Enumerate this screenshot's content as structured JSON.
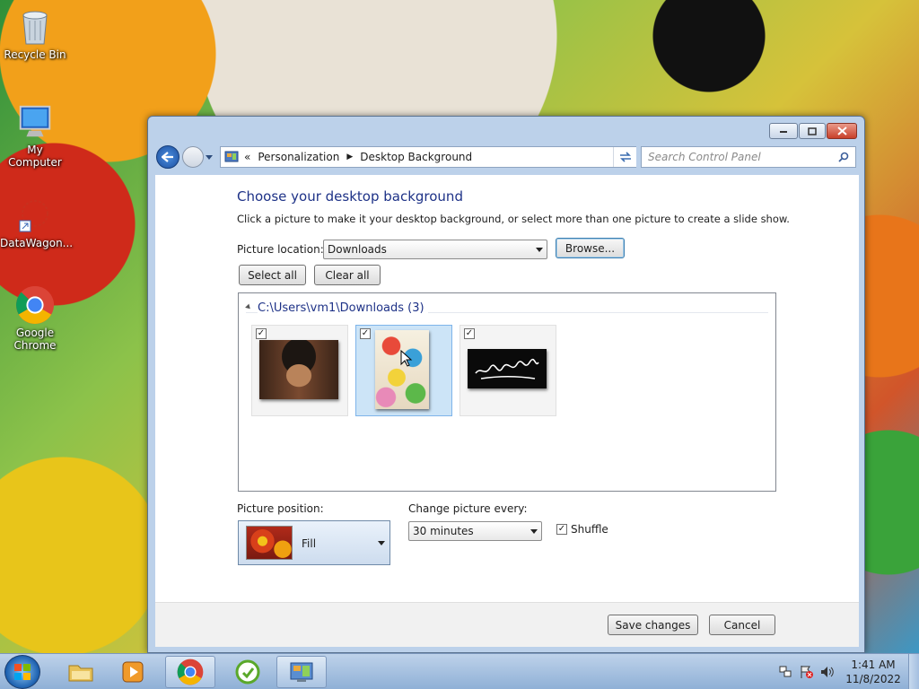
{
  "desktop": {
    "icons": [
      {
        "label": "Recycle Bin",
        "icon": "recycle-bin-icon"
      },
      {
        "label": "My Computer",
        "icon": "computer-icon"
      },
      {
        "label": "DataWagon...",
        "icon": "datawagon-icon"
      },
      {
        "label": "Google Chrome",
        "icon": "chrome-icon"
      }
    ]
  },
  "window": {
    "breadcrumb_prefix": "«",
    "breadcrumb": [
      "Personalization",
      "Desktop Background"
    ],
    "search_placeholder": "Search Control Panel",
    "heading": "Choose your desktop background",
    "description": "Click a picture to make it your desktop background, or select more than one picture to create a slide show.",
    "picture_location": {
      "label": "Picture location:",
      "value": "Downloads",
      "browse": "Browse..."
    },
    "select_all": "Select all",
    "clear_all": "Clear all",
    "group": {
      "title": "C:\\Users\\vm1\\Downloads (3)",
      "pictures": [
        {
          "name": "portrait-photo",
          "checked": true,
          "selected": false
        },
        {
          "name": "cartoon-collage",
          "checked": true,
          "selected": true
        },
        {
          "name": "black-flag-calligraphy",
          "checked": true,
          "selected": false
        }
      ]
    },
    "position": {
      "label": "Picture position:",
      "value": "Fill"
    },
    "interval": {
      "label": "Change picture every:",
      "value": "30 minutes"
    },
    "shuffle": {
      "label": "Shuffle",
      "checked": true
    },
    "save": "Save changes",
    "cancel": "Cancel"
  },
  "taskbar": {
    "time": "1:41 AM",
    "date": "11/8/2022"
  },
  "colors": {
    "heading": "#1e3287",
    "accent": "#3c7fb1"
  }
}
